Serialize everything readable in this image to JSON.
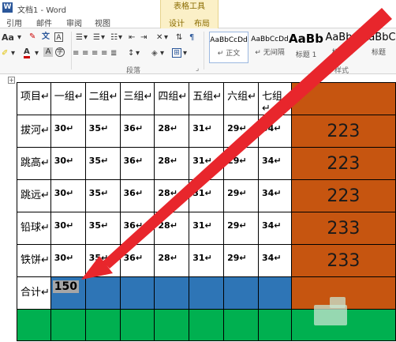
{
  "window": {
    "title": "文档1 - Word",
    "app_icon": "W"
  },
  "ribbon_tabs": [
    "引用",
    "邮件",
    "审阅",
    "视图"
  ],
  "context_tabs": {
    "group": "表格工具",
    "tabs": [
      "设计",
      "布局"
    ]
  },
  "ribbon": {
    "paragraph_group_label": "段落",
    "styles_group_label": "样式",
    "styles": [
      {
        "sample": "AaBbCcDd",
        "name": "↵ 正文"
      },
      {
        "sample": "AaBbCcDd",
        "name": "↵ 无间隔"
      },
      {
        "sample": "AaBb",
        "name": "标题 1"
      },
      {
        "sample": "AaBbC",
        "name": "标题 2"
      },
      {
        "sample": "AaBbC",
        "name": "标题"
      }
    ]
  },
  "table": {
    "headers": [
      "项目↵",
      "一组↵",
      "二组↵",
      "三组↵",
      "四组↵",
      "五组↵",
      "六组↵",
      "七组↵"
    ],
    "rows": [
      {
        "label": "拔河↵",
        "values": [
          "30↵",
          "35↵",
          "36↵",
          "28↵",
          "31↵",
          "29↵",
          "34↵"
        ],
        "total": "223"
      },
      {
        "label": "跳高↵",
        "values": [
          "30↵",
          "35↵",
          "36↵",
          "28↵",
          "31↵",
          "29↵",
          "34↵"
        ],
        "total": "223"
      },
      {
        "label": "跳远↵",
        "values": [
          "30↵",
          "35↵",
          "36↵",
          "28↵",
          "31↵",
          "29↵",
          "34↵"
        ],
        "total": "223"
      },
      {
        "label": "铅球↵",
        "values": [
          "30↵",
          "35↵",
          "36↵",
          "28↵",
          "31↵",
          "29↵",
          "34↵"
        ],
        "total": "233"
      },
      {
        "label": "铁饼↵",
        "values": [
          "30↵",
          "35↵",
          "36↵",
          "28↵",
          "31↵",
          "29↵",
          "34↵"
        ],
        "total": "233"
      }
    ],
    "sum_row": {
      "label": "合计↵",
      "first_value": "150"
    }
  },
  "colors": {
    "total_column": "#c65510",
    "sum_row": "#2e75b6",
    "bottom_row": "#00b050",
    "arrow": "#e8262c"
  }
}
